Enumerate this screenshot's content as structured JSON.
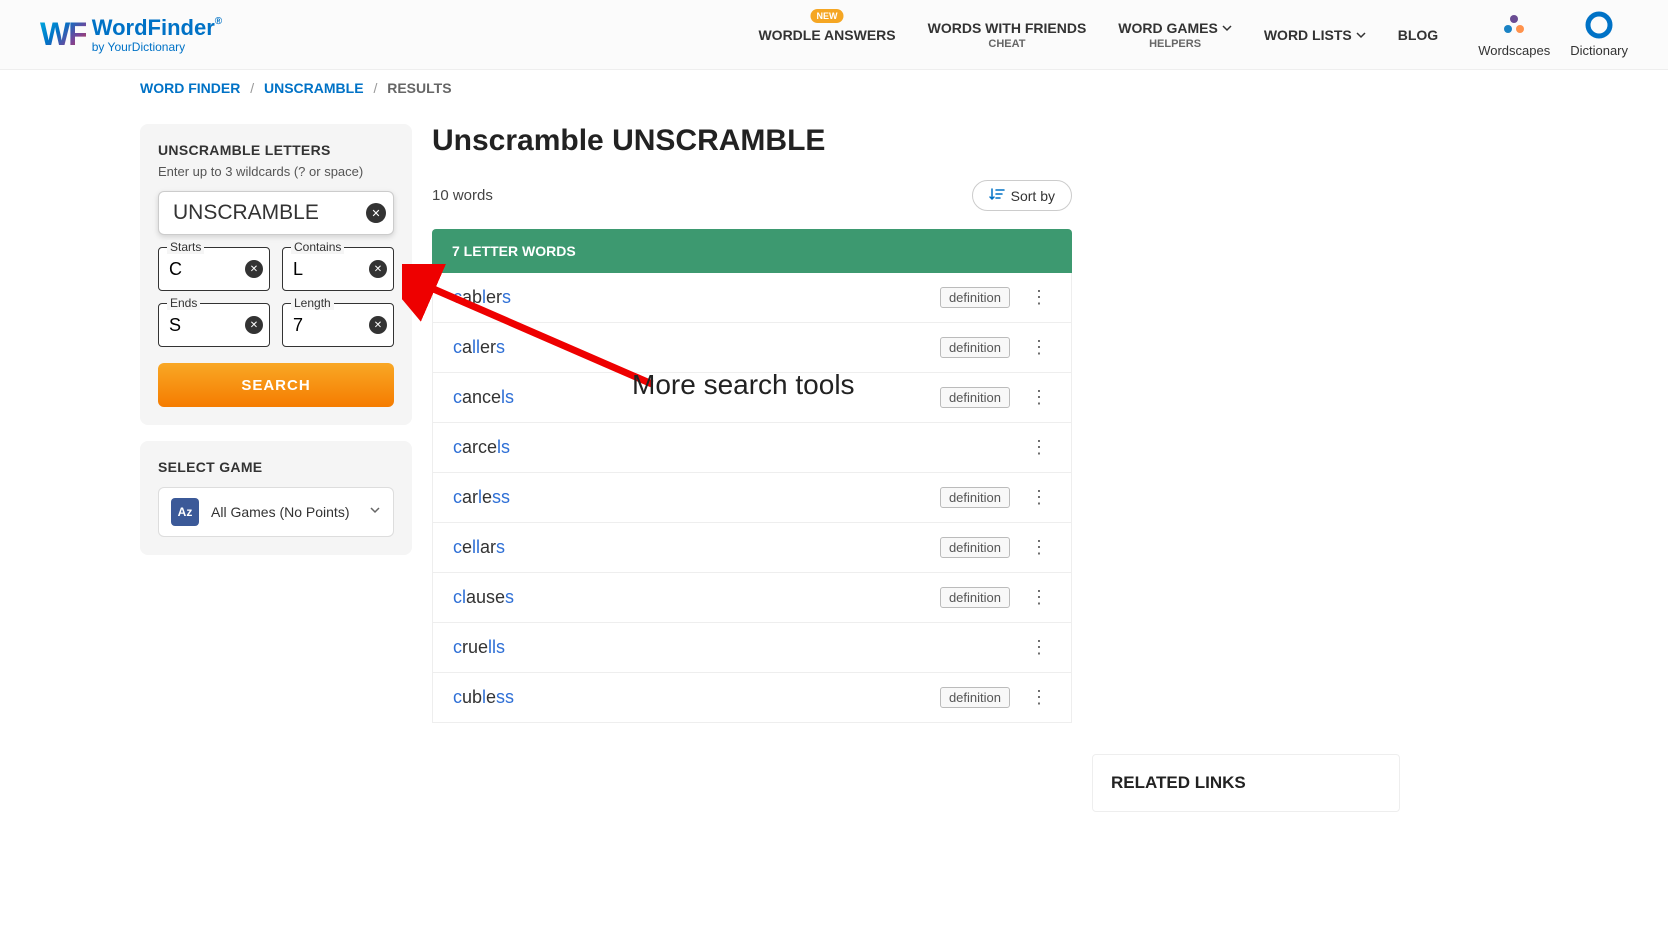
{
  "header": {
    "logo": {
      "wf": "WF",
      "main": "WordFinder",
      "sub": "by YourDictionary",
      "reg": "®"
    },
    "nav": [
      {
        "label": "WORDLE ANSWERS",
        "badge": "NEW",
        "sub": null,
        "chevron": false
      },
      {
        "label": "WORDS WITH FRIENDS",
        "badge": null,
        "sub": "CHEAT",
        "chevron": false
      },
      {
        "label": "WORD GAMES",
        "badge": null,
        "sub": "HELPERS",
        "chevron": true
      },
      {
        "label": "WORD LISTS",
        "badge": null,
        "sub": null,
        "chevron": true
      },
      {
        "label": "BLOG",
        "badge": null,
        "sub": null,
        "chevron": false
      }
    ],
    "apps": [
      {
        "label": "Wordscapes"
      },
      {
        "label": "Dictionary"
      }
    ]
  },
  "breadcrumb": {
    "items": [
      "WORD FINDER",
      "UNSCRAMBLE",
      "RESULTS"
    ]
  },
  "sidebar": {
    "unscramble_title": "UNSCRAMBLE LETTERS",
    "hint": "Enter up to 3 wildcards (? or space)",
    "main_value": "UNSCRAMBLE",
    "filters": {
      "starts": {
        "label": "Starts",
        "value": "C"
      },
      "contains": {
        "label": "Contains",
        "value": "L"
      },
      "ends": {
        "label": "Ends",
        "value": "S"
      },
      "length": {
        "label": "Length",
        "value": "7"
      }
    },
    "search_label": "SEARCH",
    "select_game_title": "SELECT GAME",
    "game_icon": "Az",
    "game_label": "All Games (No Points)"
  },
  "main": {
    "title": "Unscramble UNSCRAMBLE",
    "count": "10 words",
    "sort_label": "Sort by",
    "group_header": "7 LETTER WORDS",
    "definition_label": "definition",
    "words": [
      {
        "segments": [
          [
            "c",
            true
          ],
          [
            "ab",
            false
          ],
          [
            "l",
            true
          ],
          [
            "er",
            false
          ],
          [
            "s",
            true
          ]
        ],
        "def": true
      },
      {
        "segments": [
          [
            "c",
            true
          ],
          [
            "a",
            false
          ],
          [
            "ll",
            true
          ],
          [
            "er",
            false
          ],
          [
            "s",
            true
          ]
        ],
        "def": true
      },
      {
        "segments": [
          [
            "c",
            true
          ],
          [
            "ance",
            false
          ],
          [
            "ls",
            true
          ]
        ],
        "def": true
      },
      {
        "segments": [
          [
            "c",
            true
          ],
          [
            "arce",
            false
          ],
          [
            "ls",
            true
          ]
        ],
        "def": false
      },
      {
        "segments": [
          [
            "c",
            true
          ],
          [
            "ar",
            false
          ],
          [
            "l",
            true
          ],
          [
            "e",
            false
          ],
          [
            "ss",
            true
          ]
        ],
        "def": true
      },
      {
        "segments": [
          [
            "c",
            true
          ],
          [
            "e",
            false
          ],
          [
            "ll",
            true
          ],
          [
            "ar",
            false
          ],
          [
            "s",
            true
          ]
        ],
        "def": true
      },
      {
        "segments": [
          [
            "cl",
            true
          ],
          [
            "ause",
            false
          ],
          [
            "s",
            true
          ]
        ],
        "def": true
      },
      {
        "segments": [
          [
            "c",
            true
          ],
          [
            "rue",
            false
          ],
          [
            "lls",
            true
          ]
        ],
        "def": false
      },
      {
        "segments": [
          [
            "c",
            true
          ],
          [
            "ub",
            false
          ],
          [
            "l",
            true
          ],
          [
            "e",
            false
          ],
          [
            "ss",
            true
          ]
        ],
        "def": true
      }
    ]
  },
  "right": {
    "related_title": "RELATED LINKS"
  },
  "annotation": {
    "text": "More search tools"
  }
}
